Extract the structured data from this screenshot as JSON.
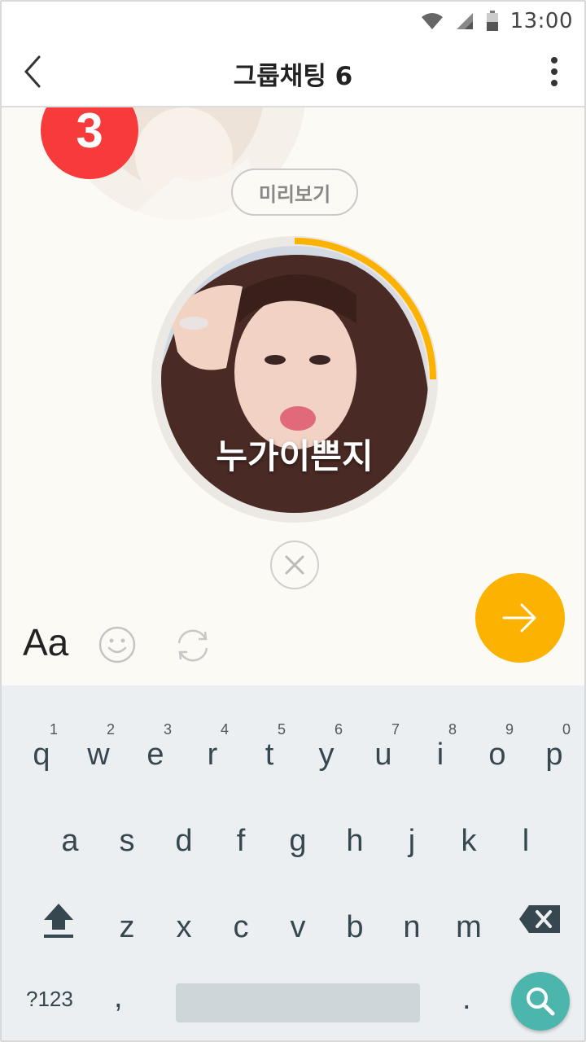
{
  "status_bar": {
    "time": "13:00",
    "icons": [
      "wifi-icon",
      "signal-icon",
      "battery-icon"
    ]
  },
  "header": {
    "title": "그룹채팅 6",
    "back_icon": "chevron-left-icon",
    "more_icon": "more-vertical-icon"
  },
  "composer": {
    "unread_count": "3",
    "preview_label": "미리보기",
    "photo_caption": "누가이쁜지",
    "upload_progress": 0.25,
    "font_tool_label": "Aa",
    "colors": {
      "accent": "#fbb200",
      "badge": "#f73a3a",
      "search": "#4db6ac"
    }
  },
  "keyboard": {
    "row1": [
      {
        "char": "q",
        "hint": "1"
      },
      {
        "char": "w",
        "hint": "2"
      },
      {
        "char": "e",
        "hint": "3"
      },
      {
        "char": "r",
        "hint": "4"
      },
      {
        "char": "t",
        "hint": "5"
      },
      {
        "char": "y",
        "hint": "6"
      },
      {
        "char": "u",
        "hint": "7"
      },
      {
        "char": "i",
        "hint": "8"
      },
      {
        "char": "o",
        "hint": "9"
      },
      {
        "char": "p",
        "hint": "0"
      }
    ],
    "row2": [
      "a",
      "s",
      "d",
      "f",
      "g",
      "h",
      "j",
      "k",
      "l"
    ],
    "row3": [
      "z",
      "x",
      "c",
      "v",
      "b",
      "n",
      "m"
    ],
    "symbols_label": "?123",
    "comma": ",",
    "period": "."
  }
}
